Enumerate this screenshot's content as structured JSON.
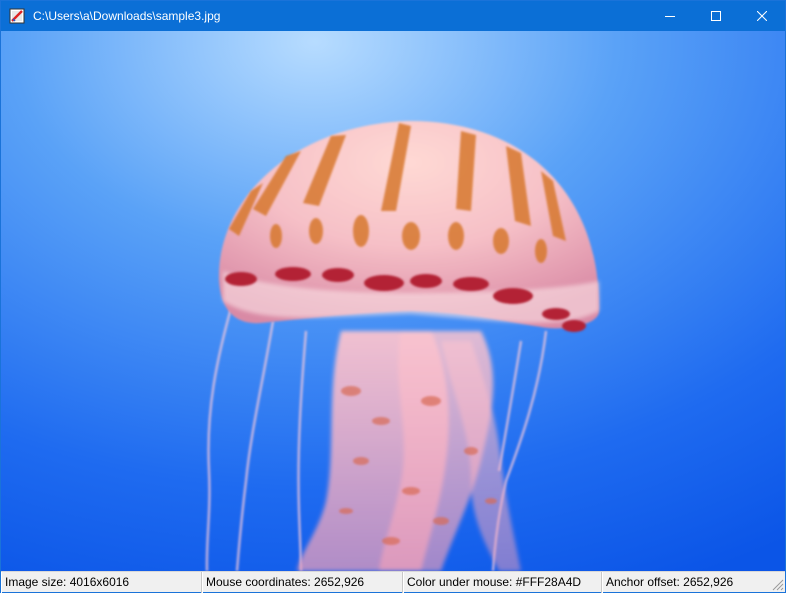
{
  "window": {
    "title": "C:\\Users\\a\\Downloads\\sample3.jpg",
    "icon": "image-viewer-app-icon",
    "controls": [
      "minimize-icon",
      "maximize-icon",
      "close-icon"
    ],
    "accent_color": "#0b6fd6"
  },
  "image": {
    "subject_icon": "jellyfish-photo",
    "background_colors": [
      "#a9d4ff",
      "#2f7cf5",
      "#0a55e6"
    ]
  },
  "status": {
    "image_size": "Image size: 4016x6016",
    "mouse_coordinates": "Mouse coordinates: 2652,926",
    "color_under_mouse": "Color under mouse: #FFF28A4D",
    "anchor_offset": "Anchor offset: 2652,926"
  }
}
